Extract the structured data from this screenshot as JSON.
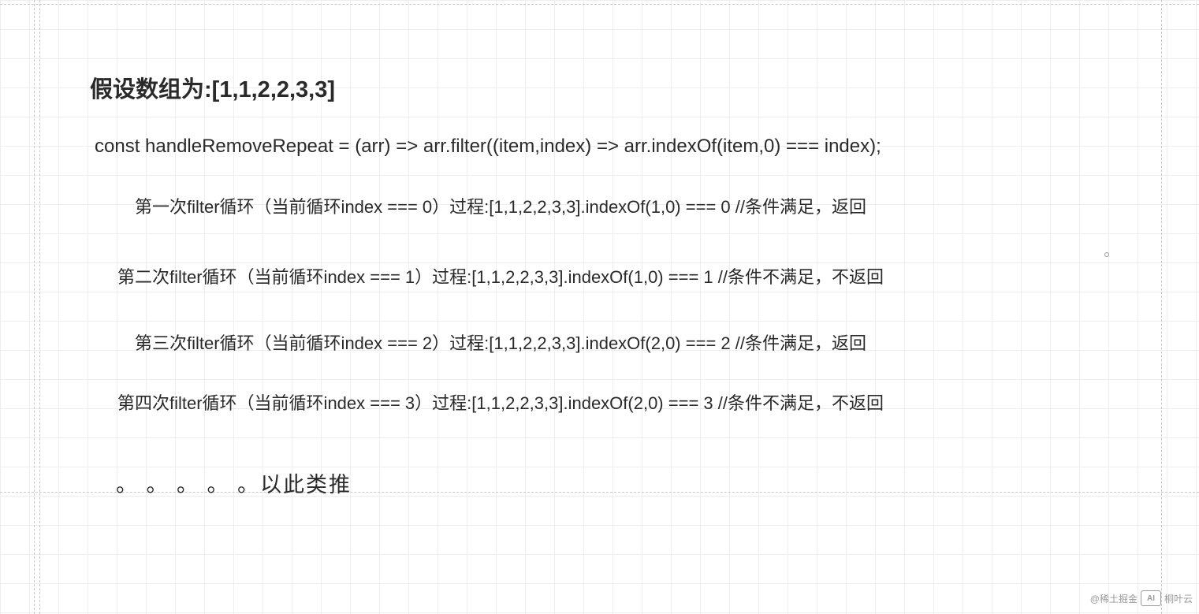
{
  "heading": "假设数组为:[1,1,2,2,3,3]",
  "code": "const handleRemoveRepeat = (arr) => arr.filter((item,index) => arr.indexOf(item,0) === index);",
  "steps": [
    "第一次filter循环（当前循环index === 0）过程:[1,1,2,2,3,3].indexOf(1,0) === 0  //条件满足，返回",
    "第二次filter循环（当前循环index === 1）过程:[1,1,2,2,3,3].indexOf(1,0) === 1  //条件不满足，不返回",
    "第三次filter循环（当前循环index === 2）过程:[1,1,2,2,3,3].indexOf(2,0) === 2  //条件满足，返回",
    "第四次filter循环（当前循环index === 3）过程:[1,1,2,2,3,3].indexOf(2,0) === 3  //条件不满足，不返回"
  ],
  "ending": "。 。 。 。 。以此类推",
  "watermark": {
    "left": "@稀土掘金",
    "badge": "AI",
    "right": "桐叶云"
  }
}
